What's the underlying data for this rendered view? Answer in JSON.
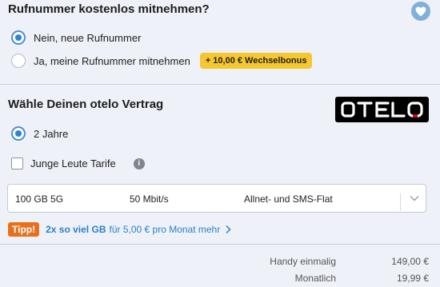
{
  "number_port": {
    "title": "Rufnummer kostenlos mitnehmen?",
    "options": [
      {
        "label": "Nein, neue Rufnummer",
        "selected": true
      },
      {
        "label": "Ja, meine Rufnummer mitnehmen",
        "selected": false
      }
    ],
    "bonus_badge": "+ 10,00 € Wechselbonus",
    "favorite_icon": "heart-icon"
  },
  "contract": {
    "title": "Wähle Deinen otelo Vertrag",
    "logo_text": "otelo",
    "duration_option": {
      "label": "2 Jahre",
      "selected": true
    },
    "young_tariff": {
      "label": "Junge Leute Tarife",
      "checked": false
    },
    "info_icon": "i"
  },
  "tariff_select": {
    "data": "100 GB 5G",
    "speed": "50 Mbit/s",
    "flat": "Allnet- und SMS-Flat"
  },
  "tip": {
    "badge": "Tipp!",
    "highlight": "2x so viel GB",
    "rest": "für 5,00 € pro Monat mehr"
  },
  "prices": [
    {
      "label": "Handy einmalig",
      "value": "149,00 €"
    },
    {
      "label": "Monatlich",
      "value": "19,99 €"
    }
  ],
  "colors": {
    "accent_blue": "#2f84d6",
    "bonus_yellow": "#f6c72e",
    "tip_orange": "#e8701d",
    "heart_bg": "#7fb1d8"
  }
}
